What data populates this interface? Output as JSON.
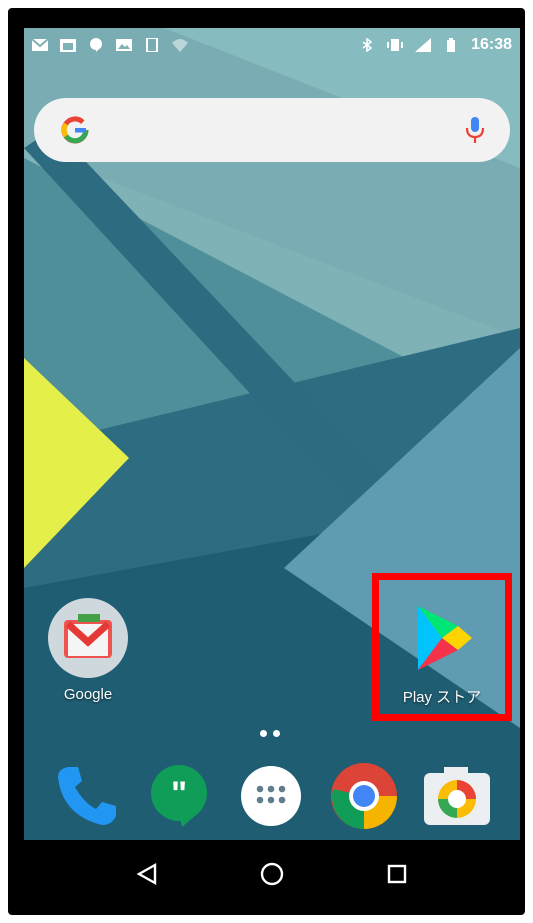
{
  "status_bar": {
    "time": "16:38",
    "left_icons": [
      "gmail-icon",
      "calendar-icon",
      "hangouts-icon",
      "gallery-icon",
      "screenshot-icon",
      "wifi-icon"
    ],
    "right_icons": [
      "bluetooth-icon",
      "vibrate-icon",
      "signal-icon",
      "battery-icon"
    ]
  },
  "search_bar": {
    "logo": "google-g-icon",
    "mic": "mic-icon"
  },
  "apps": {
    "google_folder": {
      "label": "Google"
    },
    "play_store": {
      "label": "Play ストア"
    }
  },
  "dock": {
    "items": [
      "phone-icon",
      "hangouts-icon",
      "app-drawer-icon",
      "chrome-icon",
      "camera-icon"
    ]
  },
  "nav": {
    "back": "back-icon",
    "home": "home-icon",
    "recents": "recents-icon"
  },
  "colors": {
    "highlight": "#ff0000",
    "wallpaper_dark": "#2f6f83",
    "wallpaper_light": "#8fbcc0",
    "accent_yellow": "#e4ef4a"
  }
}
